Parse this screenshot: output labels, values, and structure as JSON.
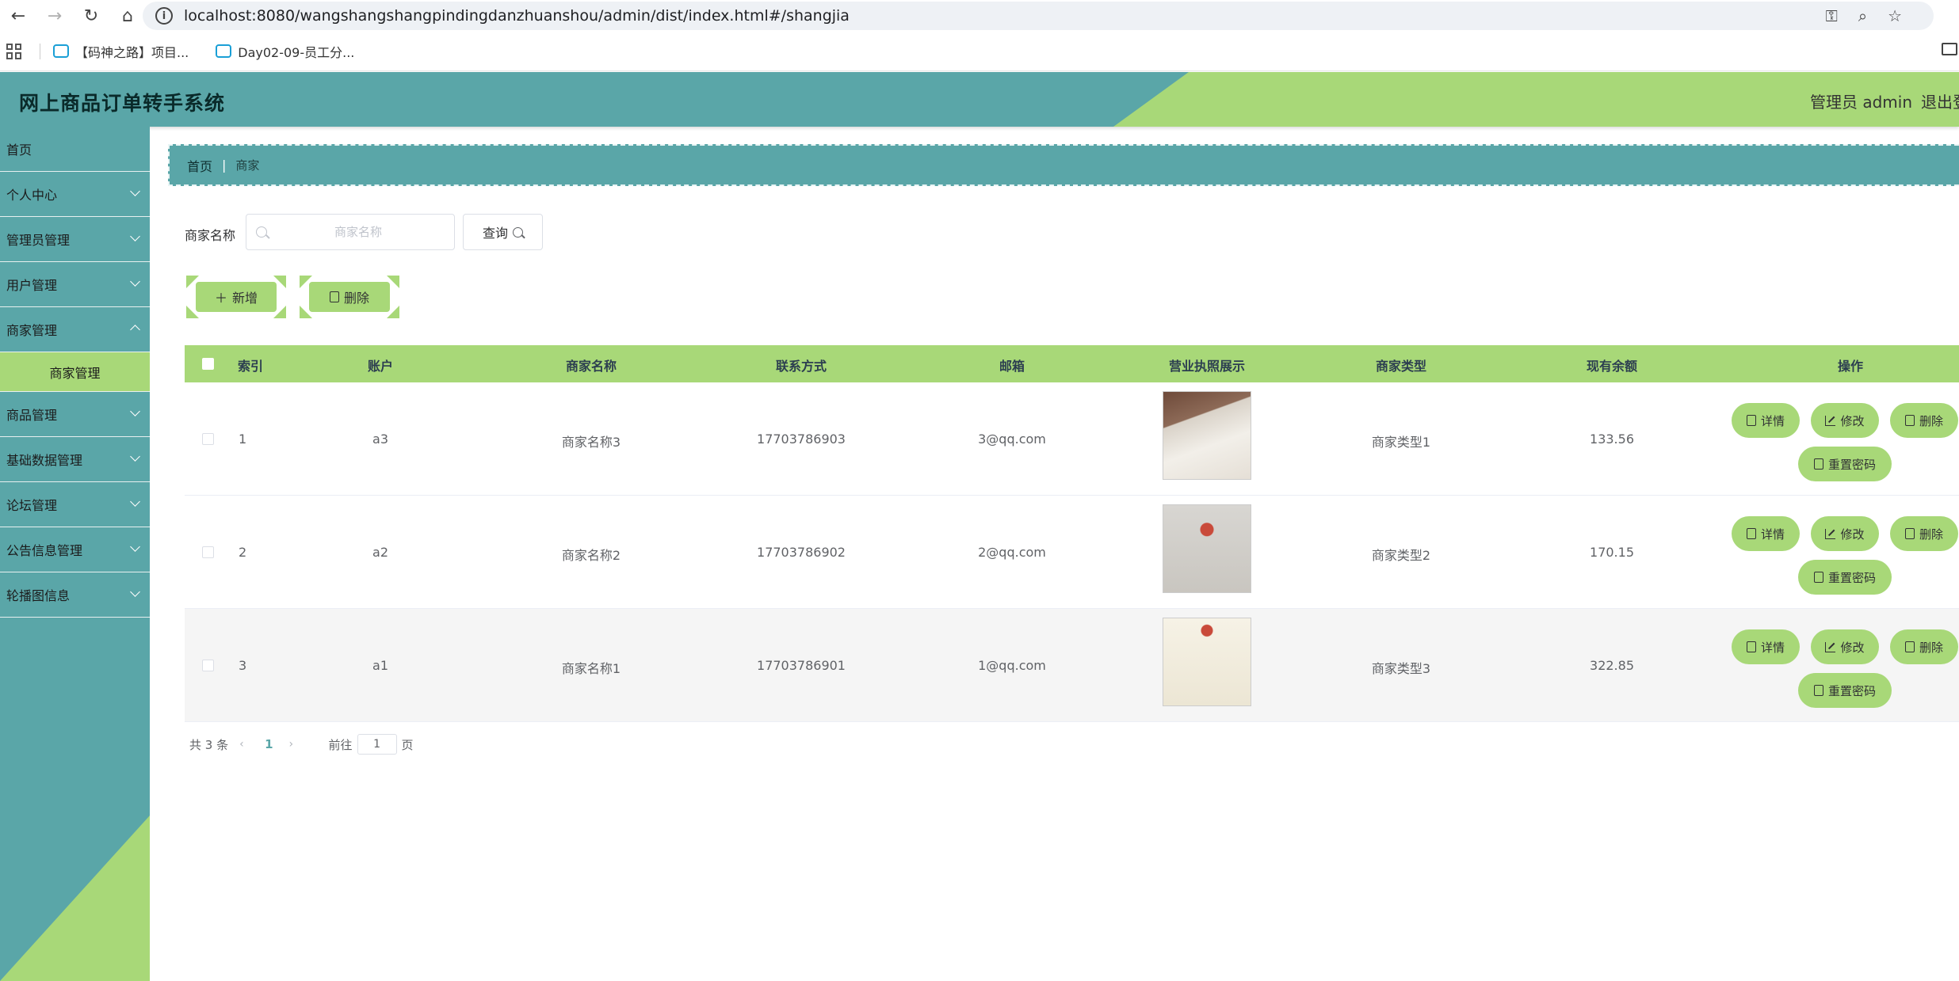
{
  "browser": {
    "url": "localhost:8080/wangshangshangpindingdanzhuanshou/admin/dist/index.html#/shangjia",
    "bookmarks": [
      "【码神之路】项目...",
      "Day02-09-员工分..."
    ]
  },
  "header": {
    "title": "网上商品订单转手系统",
    "user": "管理员 admin",
    "logout": "退出登录"
  },
  "sidebar": {
    "items": [
      {
        "label": "首页"
      },
      {
        "label": "个人中心"
      },
      {
        "label": "管理员管理"
      },
      {
        "label": "用户管理"
      },
      {
        "label": "商家管理"
      },
      {
        "label": "商品管理"
      },
      {
        "label": "基础数据管理"
      },
      {
        "label": "论坛管理"
      },
      {
        "label": "公告信息管理"
      },
      {
        "label": "轮播图信息"
      }
    ],
    "active_sub": "商家管理"
  },
  "breadcrumb": {
    "home": "首页",
    "separator": "|",
    "current": "商家"
  },
  "search": {
    "label": "商家名称",
    "placeholder": "商家名称",
    "button": "查询"
  },
  "actions": {
    "add": "新增",
    "delete": "删除"
  },
  "table": {
    "headers": [
      "索引",
      "账户",
      "商家名称",
      "联系方式",
      "邮箱",
      "营业执照展示",
      "商家类型",
      "现有余额",
      "操作"
    ],
    "rows": [
      {
        "index": "1",
        "account": "a3",
        "name": "商家名称3",
        "phone": "17703786903",
        "email": "3@qq.com",
        "type": "商家类型1",
        "balance": "133.56"
      },
      {
        "index": "2",
        "account": "a2",
        "name": "商家名称2",
        "phone": "17703786902",
        "email": "2@qq.com",
        "type": "商家类型2",
        "balance": "170.15"
      },
      {
        "index": "3",
        "account": "a1",
        "name": "商家名称1",
        "phone": "17703786901",
        "email": "1@qq.com",
        "type": "商家类型3",
        "balance": "322.85"
      }
    ],
    "row_actions": {
      "detail": "详情",
      "edit": "修改",
      "delete": "删除",
      "reset": "重置密码"
    }
  },
  "pagination": {
    "total": "共 3 条",
    "current_page": "1",
    "goto": "前往",
    "goto_value": "1",
    "page_unit": "页"
  },
  "colors": {
    "teal": "#5aa6a8",
    "green": "#a8d878"
  }
}
